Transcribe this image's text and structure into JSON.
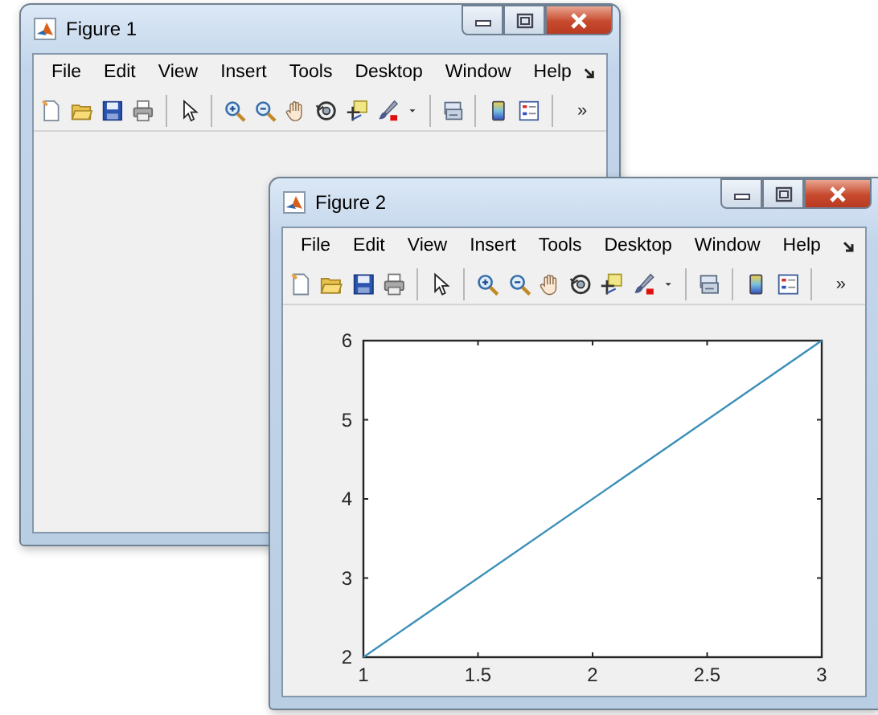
{
  "windows": [
    {
      "title": "Figure 1",
      "menu": [
        "File",
        "Edit",
        "View",
        "Insert",
        "Tools",
        "Desktop",
        "Window",
        "Help"
      ],
      "toolbar_more": "»"
    },
    {
      "title": "Figure 2",
      "menu": [
        "File",
        "Edit",
        "View",
        "Insert",
        "Tools",
        "Desktop",
        "Window",
        "Help"
      ],
      "toolbar_more": "»",
      "chart_data": {
        "type": "line",
        "x": [
          1,
          3
        ],
        "values": [
          2,
          6
        ],
        "xlim": [
          1,
          3
        ],
        "ylim": [
          2,
          6
        ],
        "xticks": [
          1,
          1.5,
          2,
          2.5,
          3
        ],
        "yticks": [
          2,
          3,
          4,
          5,
          6
        ]
      }
    }
  ]
}
